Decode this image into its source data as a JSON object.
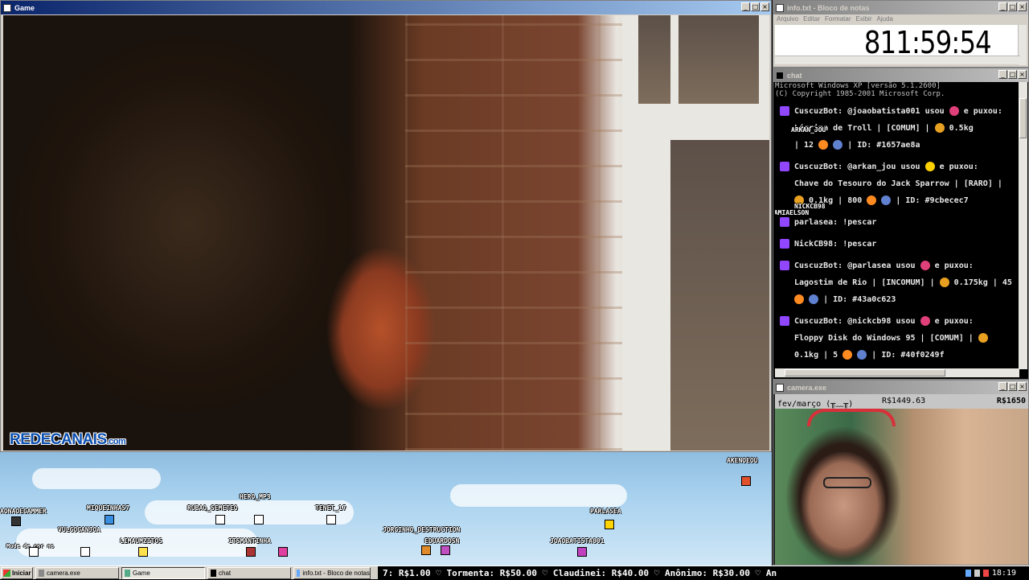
{
  "game_window": {
    "title": "Game",
    "logo_main": "REDECANAIS",
    "logo_suffix": ".com"
  },
  "notepad_window": {
    "title": "info.txt - Bloco de notas",
    "menu": [
      "Arquivo",
      "Editar",
      "Formatar",
      "Exibir",
      "Ajuda"
    ],
    "timer": "811:59:54"
  },
  "chat_window": {
    "title": "chat",
    "header_line1": "Microsoft Windows XP [versão 5.1.2600]",
    "header_line2": "(C) Copyright 1985-2001 Microsoft Corp.",
    "messages": [
      {
        "author": "CuscuzBot:",
        "text": "@joaobatista001 usou",
        "text2": "e puxou:",
        "line2": "Lágrima de Troll | [COMUM] |",
        "weight": "0.5kg",
        "line3a": "| 12",
        "line3b": "| ID: #1657ae8a"
      },
      {
        "author": "CuscuzBot:",
        "text": "@arkan_jou usou",
        "text2": "e puxou:",
        "line2": "Chave do Tesouro do Jack Sparrow | [RARO] |",
        "weight": "0.1kg | 800",
        "line3b": "| ID: #9cbecec7"
      },
      {
        "author": "parlasea:",
        "text": "!pescar"
      },
      {
        "author": "NickCB98:",
        "text": "!pescar"
      },
      {
        "author": "CuscuzBot:",
        "text": "@parlasea usou",
        "text2": "e puxou:",
        "line2": "Lagostim de Rio | [INCOMUM] |",
        "weight": "0.175kg | 45",
        "line3b": "| ID: #43a0c623"
      },
      {
        "author": "CuscuzBot:",
        "text": "@nickcb98 usou",
        "text2": "e puxou:",
        "line2": "Floppy Disk do Windows 95 | [COMUM] |",
        "weight": "0.1kg | 5",
        "line3b": "| ID: #40f0249f"
      }
    ],
    "floating_names": [
      "ARKAN_JOU",
      "NICKCB98",
      "JAMIAELSON"
    ]
  },
  "camera_window": {
    "title": "camera.exe",
    "label": "fev/março (╥﹏╥)",
    "value1": "R$1449.63",
    "value2": "R$1650"
  },
  "overlay": {
    "viewers": [
      "AKENOEOU",
      "MIQUEINHAS7",
      "HERO_MP3",
      "RUBAO_SEMETEO",
      "TENET_17",
      "PARLASEA",
      "AONAOEGAMMER",
      "VULGOGANJOA",
      "LIMAUMZITOS",
      "ITSMANTINHA",
      "JORGINHO_DESTRUCTION",
      "EDUARDOSN",
      "JOAOBATISTA001"
    ],
    "small_note": "Mude de cor no"
  },
  "taskbar": {
    "start": "Iniciar",
    "tasks": [
      "camera.exe",
      "Game",
      "chat",
      "info.txt - Bloco de notas"
    ],
    "ticker": "7: R$1.00  ♡ Tormenta: R$50.00  ♡ Claudinei: R$40.00  ♡ Anônimo: R$30.00  ♡ An",
    "clock": "18:19"
  }
}
